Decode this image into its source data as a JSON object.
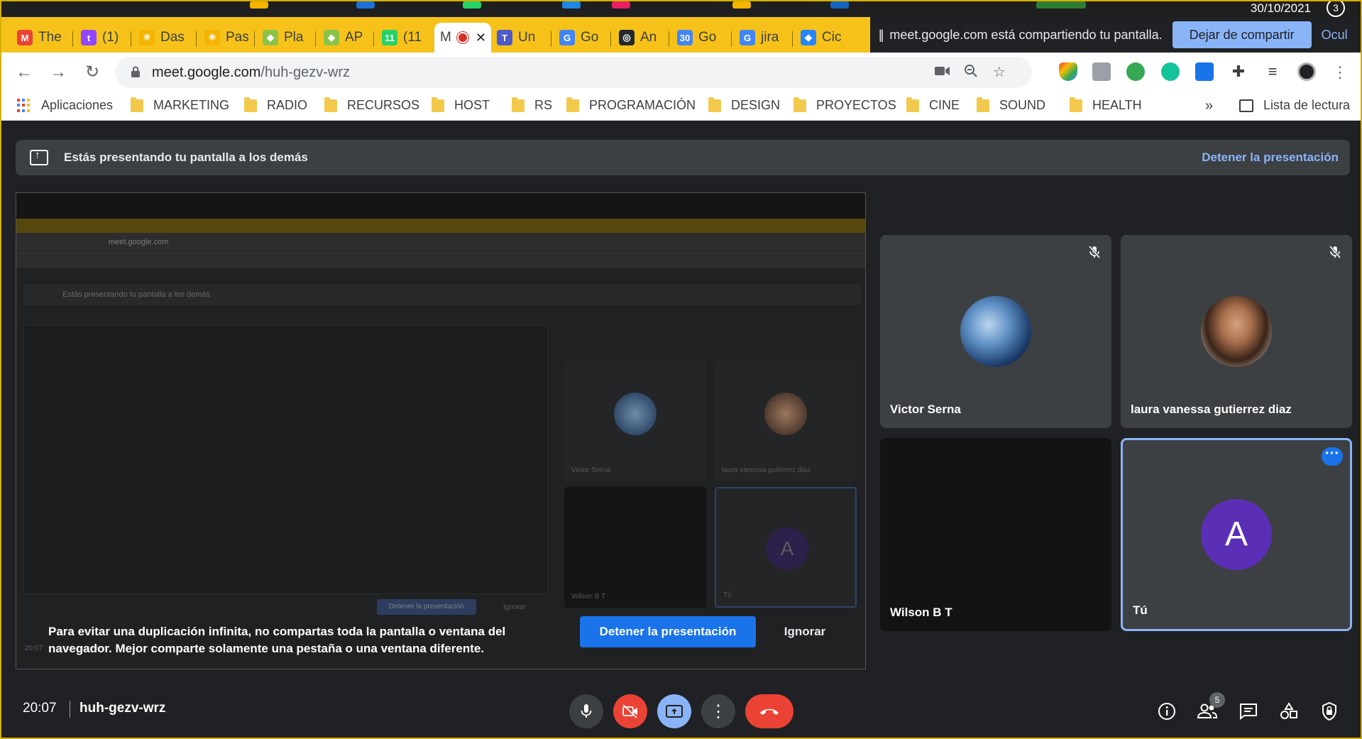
{
  "os": {
    "date": "30/10/2021",
    "notification_count": "3"
  },
  "tabs": [
    {
      "label": "The",
      "color": "#ea4335",
      "glyph": "M"
    },
    {
      "label": "(1)",
      "color": "#9146ff",
      "glyph": "t"
    },
    {
      "label": "Das",
      "color": "#f4b400",
      "glyph": "☀"
    },
    {
      "label": "Pas",
      "color": "#f4b400",
      "glyph": "☀"
    },
    {
      "label": "Pla",
      "color": "#8bc34a",
      "glyph": "◆"
    },
    {
      "label": "AP",
      "color": "#8bc34a",
      "glyph": "◆"
    },
    {
      "label": "(11",
      "color": "#25d366",
      "glyph": "11"
    },
    {
      "label": "M",
      "color": "",
      "glyph": ""
    },
    {
      "label": "Un",
      "color": "#5059c9",
      "glyph": "T"
    },
    {
      "label": "Go",
      "color": "#4285f4",
      "glyph": "G"
    },
    {
      "label": "An",
      "color": "#24292e",
      "glyph": "◎"
    },
    {
      "label": "Go",
      "color": "#4285f4",
      "glyph": "30"
    },
    {
      "label": "jira",
      "color": "#4285f4",
      "glyph": "G"
    },
    {
      "label": "Cic",
      "color": "#2684ff",
      "glyph": "◆"
    }
  ],
  "share_bar": {
    "message": "meet.google.com está compartiendo tu pantalla.",
    "stop_label": "Dejar de compartir",
    "hide_label": "Ocul"
  },
  "address": {
    "domain": "meet.google.com",
    "path": "/huh-gezv-wrz"
  },
  "bookmarks": {
    "apps_label": "Aplicaciones",
    "folders": [
      "MARKETING",
      "RADIO",
      "RECURSOS",
      "HOST",
      "RS",
      "PROGRAMACIÓN",
      "DESIGN",
      "PROYECTOS",
      "CINE",
      "SOUND",
      "HEALTH"
    ],
    "overflow": "»",
    "reading_list": "Lista de lectura"
  },
  "presenting": {
    "banner_text": "Estás presentando tu pantalla a los demás",
    "stop_link": "Detener la presentación"
  },
  "preview": {
    "warning": "Para evitar una duplicación infinita, no compartas toda la pantalla o ventana del navegador. Mejor comparte solamente una pestaña o una ventana diferente.",
    "stop_button": "Detener la presentación",
    "ignore_button": "Ignorar"
  },
  "participants": [
    {
      "name": "Victor Serna",
      "muted": true
    },
    {
      "name": "laura vanessa gutierrez diaz",
      "muted": true
    },
    {
      "name": "Wilson B T",
      "muted": false
    },
    {
      "name": "Tú",
      "avatar_letter": "A",
      "muted": false
    }
  ],
  "bottom": {
    "time": "20:07",
    "meeting_code": "huh-gezv-wrz",
    "participant_count": "5"
  },
  "colors": {
    "tabbar": "#f6c21a",
    "meet_bg": "#202124",
    "accent_blue": "#1a73e8",
    "danger_red": "#ea4335",
    "self_avatar": "#5b2fb5"
  }
}
